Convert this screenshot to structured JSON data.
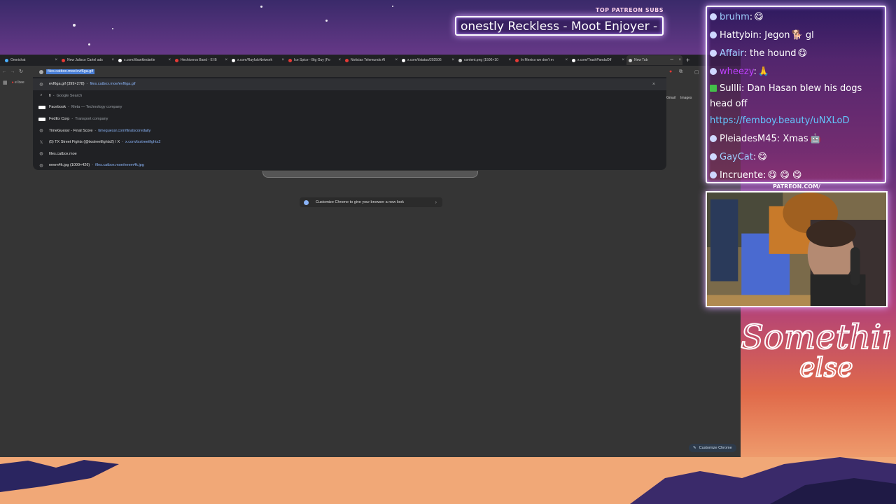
{
  "overlay": {
    "patreon_label": "TOP PATREON SUBS",
    "patreon_ticker": "onestly Reckless - Moot Enjoyer - Le",
    "patreon_url": "PATREON.COM/"
  },
  "browser": {
    "tabs": [
      {
        "title": "Omnichat",
        "color": "#4ab0ff"
      },
      {
        "title": "New Jalisco Cartel ads",
        "color": "#e53935"
      },
      {
        "title": "x.com/i/bankledartle",
        "color": "#ffffff"
      },
      {
        "title": "Hechiceros Band - El B",
        "color": "#e53935"
      },
      {
        "title": "x.com/RayfuloNetwork",
        "color": "#ffffff"
      },
      {
        "title": "Ice Spice - Big Guy (Fo",
        "color": "#e53935"
      },
      {
        "title": "Noticias Telemundo Al",
        "color": "#e53935"
      },
      {
        "title": "x.com/i/status/202506",
        "color": "#ffffff"
      },
      {
        "title": "content.png (1500×10",
        "color": "#cccccc"
      },
      {
        "title": "In Mexico we don't m",
        "color": "#e53935"
      },
      {
        "title": "x.com/TrashPandaOff",
        "color": "#ffffff"
      },
      {
        "title": "New Tab",
        "color": "#cccccc"
      }
    ],
    "omnibox_value": "files.catbox.moe/evf6ga.gif",
    "bookmark_label": "el bee",
    "suggestions": [
      {
        "icon": "globe-icon",
        "main": "evf6ga.gif (399×278)",
        "sep": "-",
        "sub": "",
        "url": "files.catbox.moe/evf6ga.gif"
      },
      {
        "icon": "search-icon",
        "main": "fi",
        "sep": "-",
        "sub": "Google Search",
        "url": ""
      },
      {
        "icon": "facebook-icon",
        "main": "Facebook",
        "sep": "-",
        "sub": "Meta — Technology company",
        "url": ""
      },
      {
        "icon": "fedex-icon",
        "main": "FedEx Corp",
        "sep": "-",
        "sub": "Transport company",
        "url": ""
      },
      {
        "icon": "globe-icon",
        "main": "TimeGuessr - Final Score",
        "sep": "-",
        "sub": "",
        "url": "timeguessr.com/finalscoredaily"
      },
      {
        "icon": "x-icon",
        "main": "(5) TX Street Fights (@txstreetfights2) / X",
        "sep": "-",
        "sub": "",
        "url": "x.com/txstreetfights2"
      },
      {
        "icon": "globe-icon",
        "main": "files.catbox.moe",
        "sep": "",
        "sub": "",
        "url": ""
      },
      {
        "icon": "globe-icon",
        "main": "neem4k.jpg (1000×426)",
        "sep": "-",
        "sub": "",
        "url": "files.catbox.moe/neem4k.jpg"
      }
    ],
    "gmail": "Gmail",
    "images": "Images",
    "customize_pill": "Customize Chrome to give your browser a new look",
    "customize_button": "Customize Chrome"
  },
  "chat": {
    "messages": [
      {
        "user": "bruhm",
        "user_color": "#9fd0ff",
        "text": ":",
        "emote": "😋",
        "badge": "default"
      },
      {
        "user": "Hattybin",
        "user_color": "#ffffff",
        "text": ": Jegon",
        "emote": "🐕",
        "tail": " gl",
        "badge": "default"
      },
      {
        "user": "Affair",
        "user_color": "#9fd0ff",
        "text": ": the hound",
        "emote": "😋",
        "badge": "default"
      },
      {
        "user": "wheezy",
        "user_color": "#c040ff",
        "text": ":",
        "emote": "🙏",
        "badge": "default"
      },
      {
        "user": "Sullli",
        "user_color": "#ffffff",
        "text": ": Dan Hasan blew his dogs head off",
        "emote": "",
        "badge": "green"
      },
      {
        "user": "",
        "user_color": "#64c8ff",
        "text": "https://femboy.beauty/uNXLoD",
        "emote": "",
        "badge": "none"
      },
      {
        "user": "PleiadesM45",
        "user_color": "#ffffff",
        "text": ": Xmas",
        "emote": "🤖",
        "badge": "default"
      },
      {
        "user": "GayCat",
        "user_color": "#9fd0ff",
        "text": ":",
        "emote": "😋",
        "badge": "default"
      },
      {
        "user": "Incruente",
        "user_color": "#ffffff",
        "text": ":",
        "emote": "😋 😋 😋",
        "badge": "default"
      }
    ]
  },
  "signature": {
    "line1": "Something",
    "line2": "else"
  },
  "colors": {
    "browser_bg": "#353535",
    "dropdown_bg": "#202124",
    "link": "#8ab4f8",
    "neon": "#ffffff"
  }
}
